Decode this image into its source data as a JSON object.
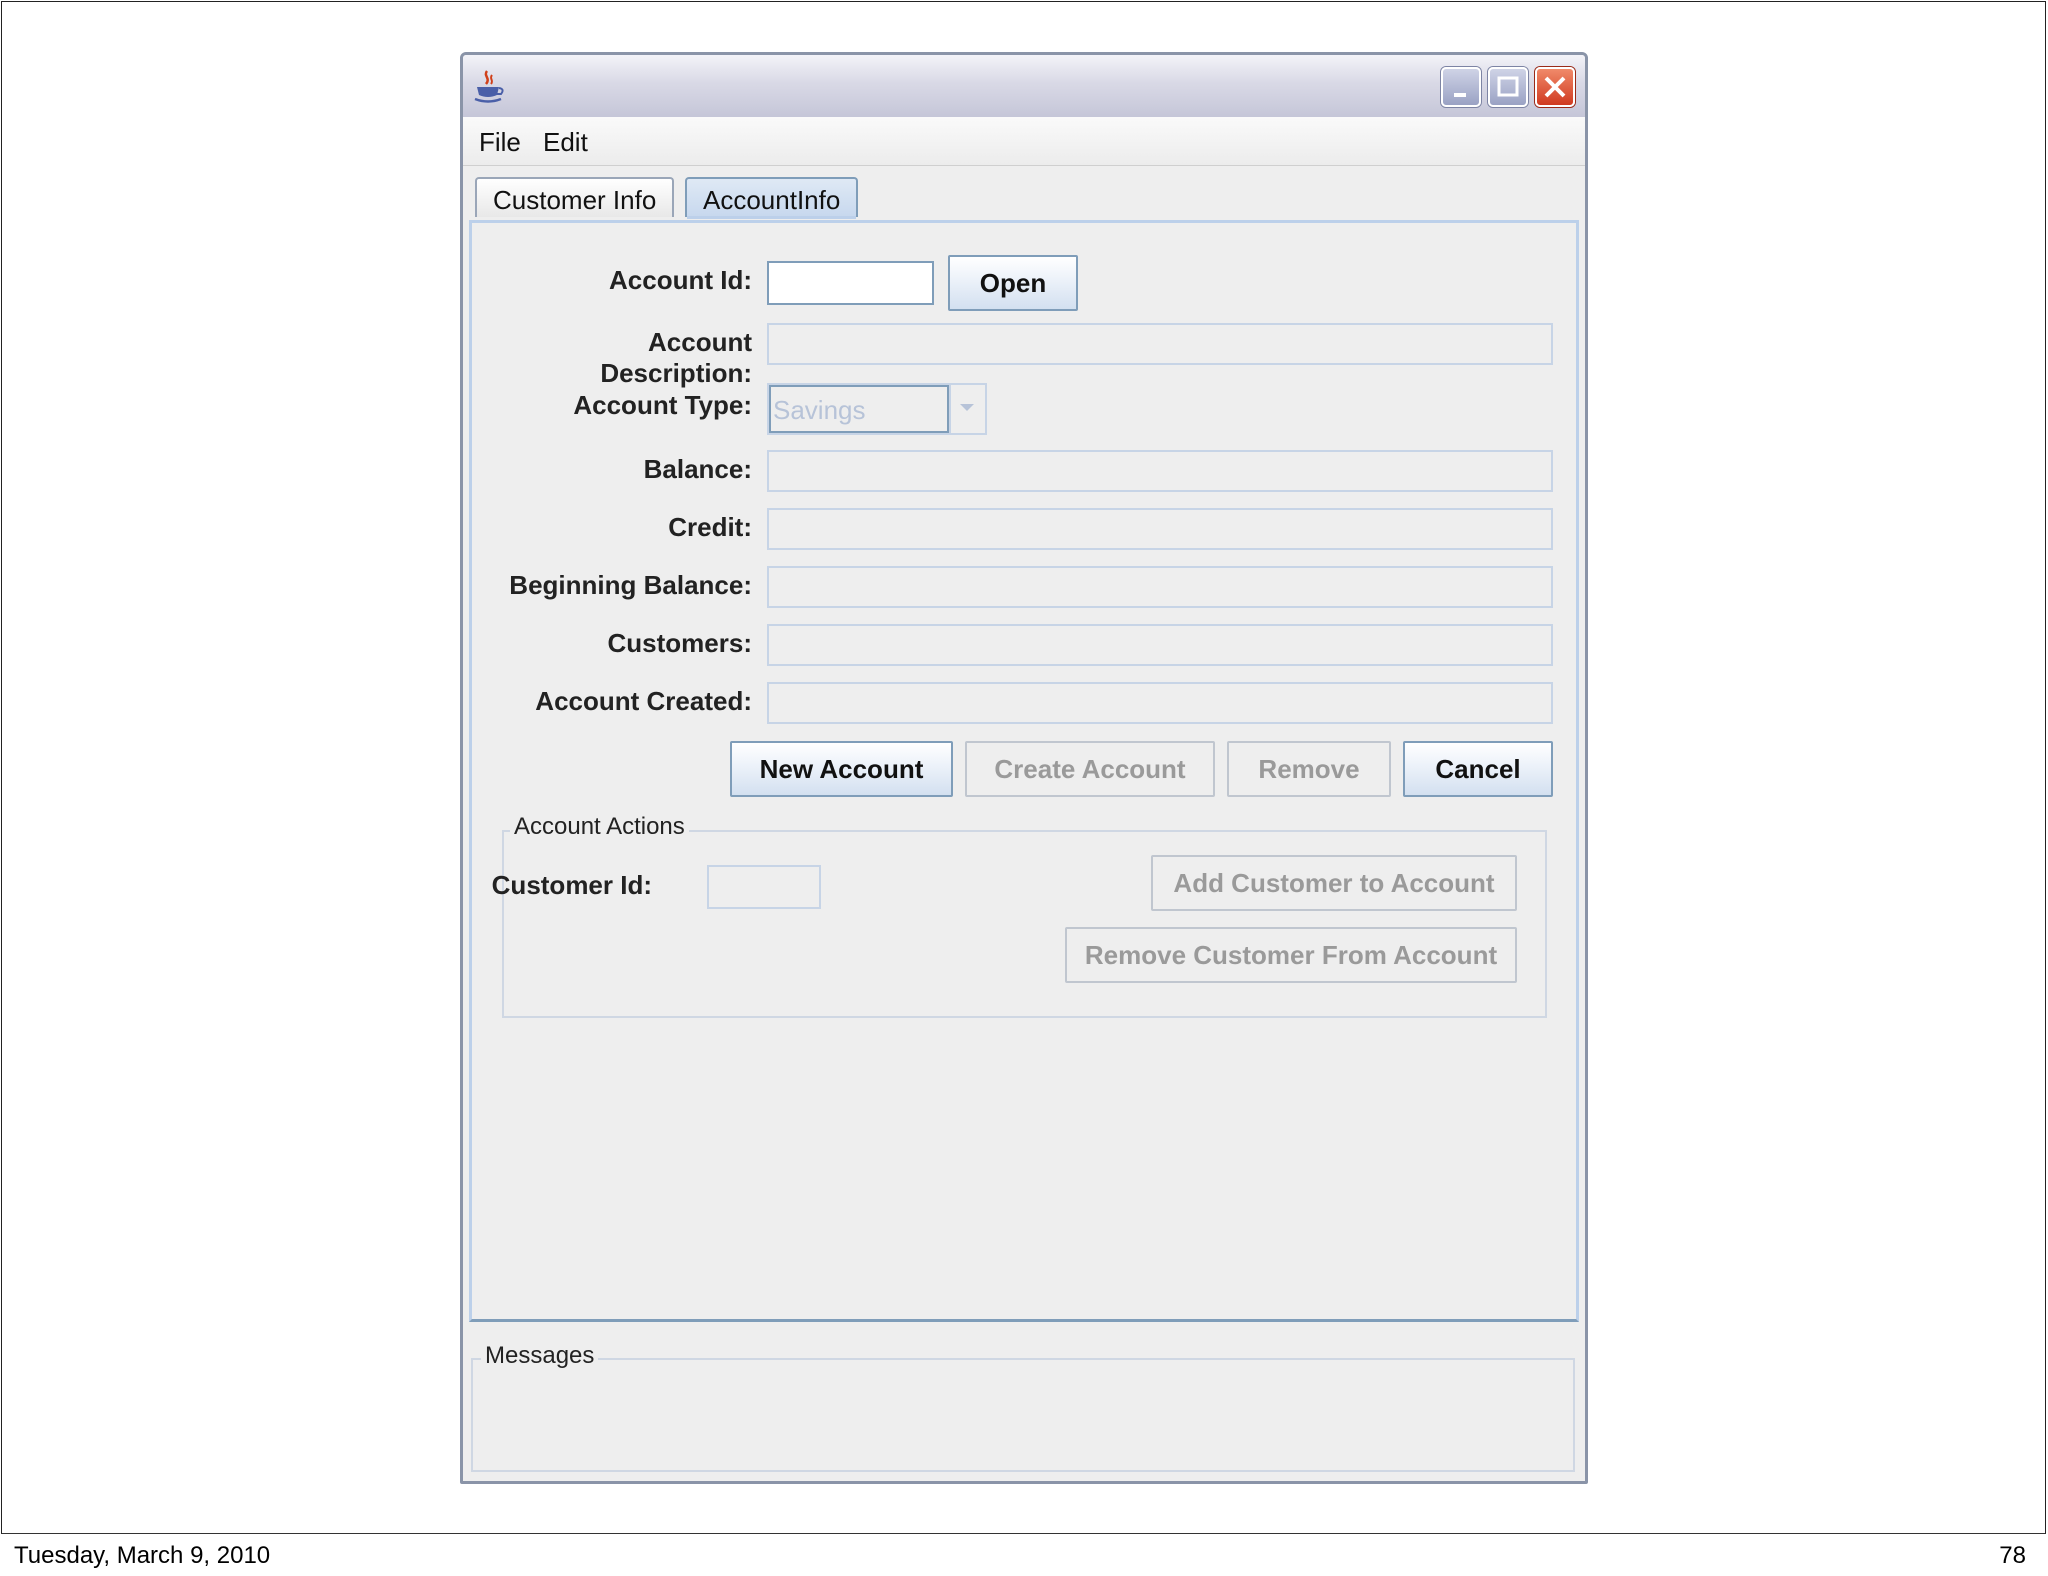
{
  "footer": {
    "date": "Tuesday, March 9, 2010",
    "page": "78"
  },
  "window": {
    "icons": {
      "app": "java-coffee-icon",
      "minimize": "minimize-icon",
      "maximize": "maximize-icon",
      "close": "close-icon"
    }
  },
  "menu": {
    "file": "File",
    "edit": "Edit"
  },
  "tabs": {
    "customer": "Customer Info",
    "account": "AccountInfo"
  },
  "form": {
    "account_id_label": "Account Id:",
    "open_button": "Open",
    "account_description_label": "Account Description:",
    "account_type_label": "Account Type:",
    "account_type_value": "Savings",
    "balance_label": "Balance:",
    "credit_label": "Credit:",
    "beginning_balance_label": "Beginning Balance:",
    "customers_label": "Customers:",
    "account_created_label": "Account Created:"
  },
  "buttons": {
    "new_account": "New Account",
    "create_account": "Create Account",
    "remove": "Remove",
    "cancel": "Cancel"
  },
  "account_actions": {
    "title": "Account Actions",
    "customer_id_label": "Customer Id:",
    "add_customer": "Add Customer to Account",
    "remove_customer": "Remove Customer From Account"
  },
  "messages": {
    "title": "Messages"
  },
  "colors": {
    "accent_border": "#7f9db9",
    "panel_bg": "#eeeeee",
    "close_red": "#d03a20"
  }
}
